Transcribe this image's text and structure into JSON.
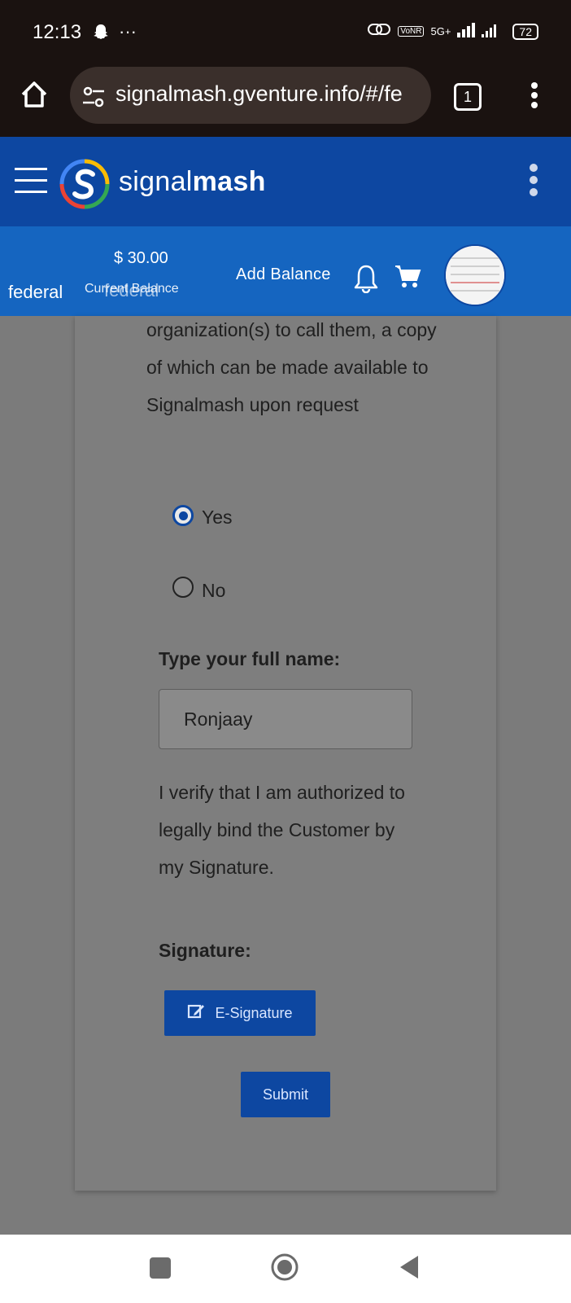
{
  "status_bar": {
    "time": "12:13",
    "dots": "···",
    "network": "5G+",
    "battery": "72"
  },
  "browser": {
    "url": "signalmash.gventure.info/#/fe",
    "tab_count": "1"
  },
  "app": {
    "brand_light": "signal",
    "brand_bold": "mash",
    "accent": "#0d47a1"
  },
  "balance_bar": {
    "federal": "federal",
    "amount": "$ 30.00",
    "label": "Current Balance",
    "federal_overlay": "federal",
    "add_balance": "Add Balance"
  },
  "form": {
    "paragraph": "organization(s) to call them, a copy of which can be made available to Signalmash upon request",
    "options": [
      {
        "label": "Yes",
        "checked": true
      },
      {
        "label": "No",
        "checked": false
      }
    ],
    "name_label": "Type your full name:",
    "name_value": "Ronjaay",
    "verify_text": "I verify that I am authorized to legally bind the Customer by my Signature.",
    "signature_label": "Signature:",
    "esign_label": "E-Signature",
    "submit_label": "Submit"
  }
}
